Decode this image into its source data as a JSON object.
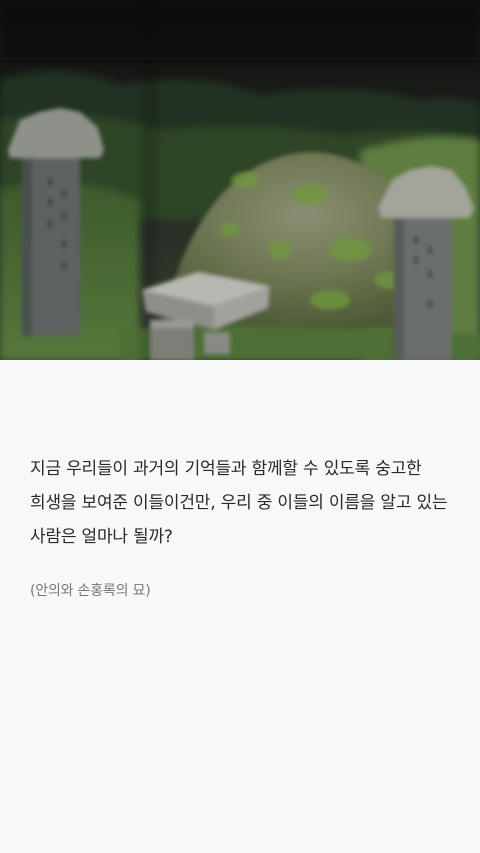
{
  "article": {
    "body_text": "지금 우리들이 과거의 기억들과 함께할 수 있도록 숭고한 희생을 보여준 이들이건만, 우리 중 이들의 이름을 알고 있는 사람은 얼마나 될까?",
    "caption": "(안의와 손홍록의 묘)"
  },
  "colors": {
    "page_background": "#f8f8f8",
    "body_text": "#2a2a2a",
    "caption_text": "#777777"
  }
}
